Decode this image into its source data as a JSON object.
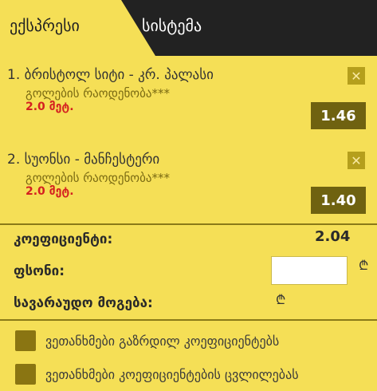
{
  "tabs": {
    "active": "ექსპრესი",
    "inactive": "სისტემა"
  },
  "bets": [
    {
      "index": "1.",
      "match": "ბრისტოლ სიტი - კრ. პალასი",
      "market": "გოლების რაოდენობა***",
      "stake": "2.0 მეტ.",
      "odds": "1.46",
      "close_icon": "close-icon"
    },
    {
      "index": "2.",
      "match": "სუონსი - მანჩესტერი",
      "market": "გოლების რაოდენობა***",
      "stake": "2.0 მეტ.",
      "odds": "1.40",
      "close_icon": "close-icon"
    }
  ],
  "summary": {
    "coef_label": "კოეფიციენტი:",
    "coef_value": "2.04",
    "stake_label": "ფსონი:",
    "stake_value": "",
    "win_label": "სავარაუდო მოგება:",
    "currency": "₾"
  },
  "options": [
    {
      "label": "ვეთანხმები გაზრდილ კოეფიციენტებს",
      "checked": false
    },
    {
      "label": "ვეთანხმები კოეფიციენტების ცვლილებას",
      "checked": false
    }
  ],
  "colors": {
    "panel": "#f5df56",
    "header": "#222222",
    "odds_bg": "#6f6210",
    "stake_red": "#d42020",
    "checkbox": "#8a7512"
  }
}
